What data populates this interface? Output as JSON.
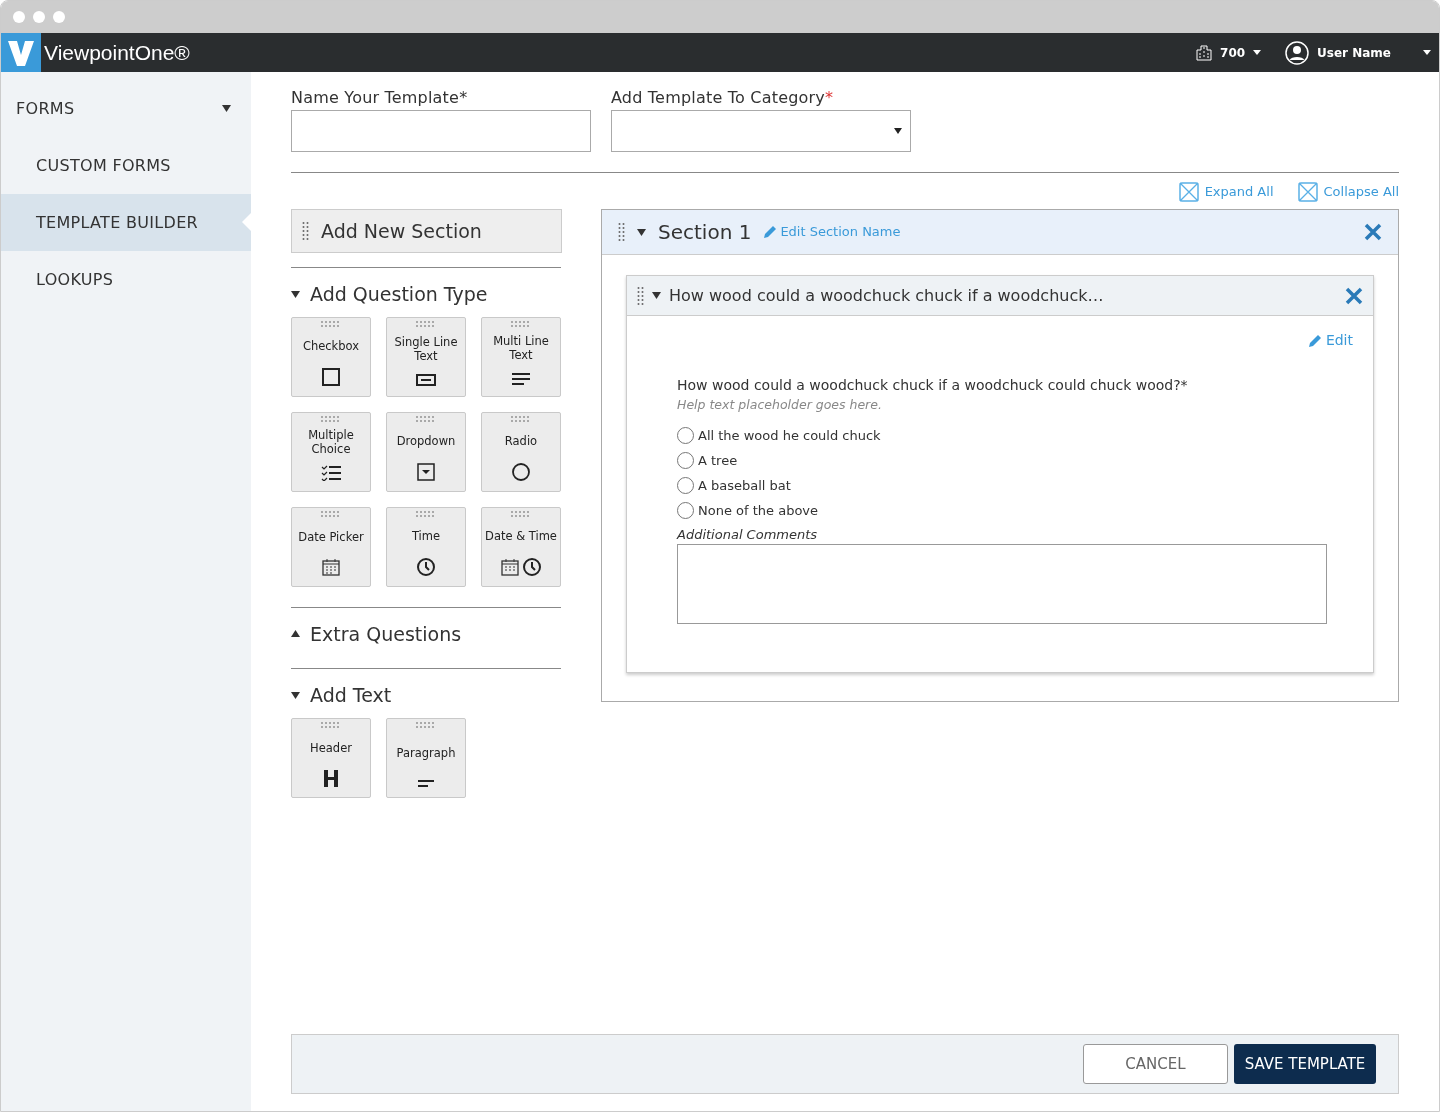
{
  "navbar": {
    "brand": "ViewpointOne®",
    "company": "700",
    "user": "User Name"
  },
  "sidebar": {
    "items": [
      {
        "label": "FORMS",
        "kind": "group",
        "selected": false
      },
      {
        "label": "CUSTOM FORMS",
        "kind": "link",
        "selected": false
      },
      {
        "label": "TEMPLATE BUILDER",
        "kind": "link",
        "selected": true
      },
      {
        "label": "LOOKUPS",
        "kind": "link",
        "selected": false
      }
    ]
  },
  "template_name": {
    "label": "Name Your Template*"
  },
  "category": {
    "label": "Add Template To Category",
    "required_mark": "*"
  },
  "toolbar": {
    "expand_all": "Expand All",
    "collapse_all": "Collapse All"
  },
  "add_section": "Add New Section",
  "palette": [
    {
      "title": "Add Question Type",
      "expanded": true,
      "tiles": [
        {
          "label": "Checkbox",
          "kind": "checkbox"
        },
        {
          "label": "Single Line Text",
          "kind": "single"
        },
        {
          "label": "Multi Line Text",
          "kind": "multi"
        },
        {
          "label": "Multiple Choice",
          "kind": "choice"
        },
        {
          "label": "Dropdown",
          "kind": "dropdown"
        },
        {
          "label": "Radio",
          "kind": "radio"
        },
        {
          "label": "Date Picker",
          "kind": "date"
        },
        {
          "label": "Time",
          "kind": "time"
        },
        {
          "label": "Date & Time",
          "kind": "datetime"
        }
      ]
    },
    {
      "title": "Extra Questions",
      "expanded": false
    },
    {
      "title": "Add Text",
      "expanded": true,
      "tiles": [
        {
          "label": "Header",
          "kind": "header"
        },
        {
          "label": "Paragraph",
          "kind": "paragraph"
        }
      ]
    }
  ],
  "section": {
    "title": "Section 1",
    "edit_name": "Edit Section Name",
    "expanded": true,
    "question": {
      "title": "How wood could a woodchuck chuck if a woodchuck…",
      "expanded": true,
      "edit": "Edit",
      "text": "How wood could a woodchuck chuck if a woodchuck could chuck wood?*",
      "help": "Help text placeholder goes here.",
      "options": [
        {
          "label": "All the wood he could chuck",
          "selected": false
        },
        {
          "label": "A tree",
          "selected": false
        },
        {
          "label": "A baseball bat",
          "selected": false
        },
        {
          "label": "None of the above",
          "selected": false
        }
      ],
      "comments_label": "Additional Comments"
    }
  },
  "footer": {
    "cancel": "CANCEL",
    "save": "SAVE TEMPLATE"
  }
}
